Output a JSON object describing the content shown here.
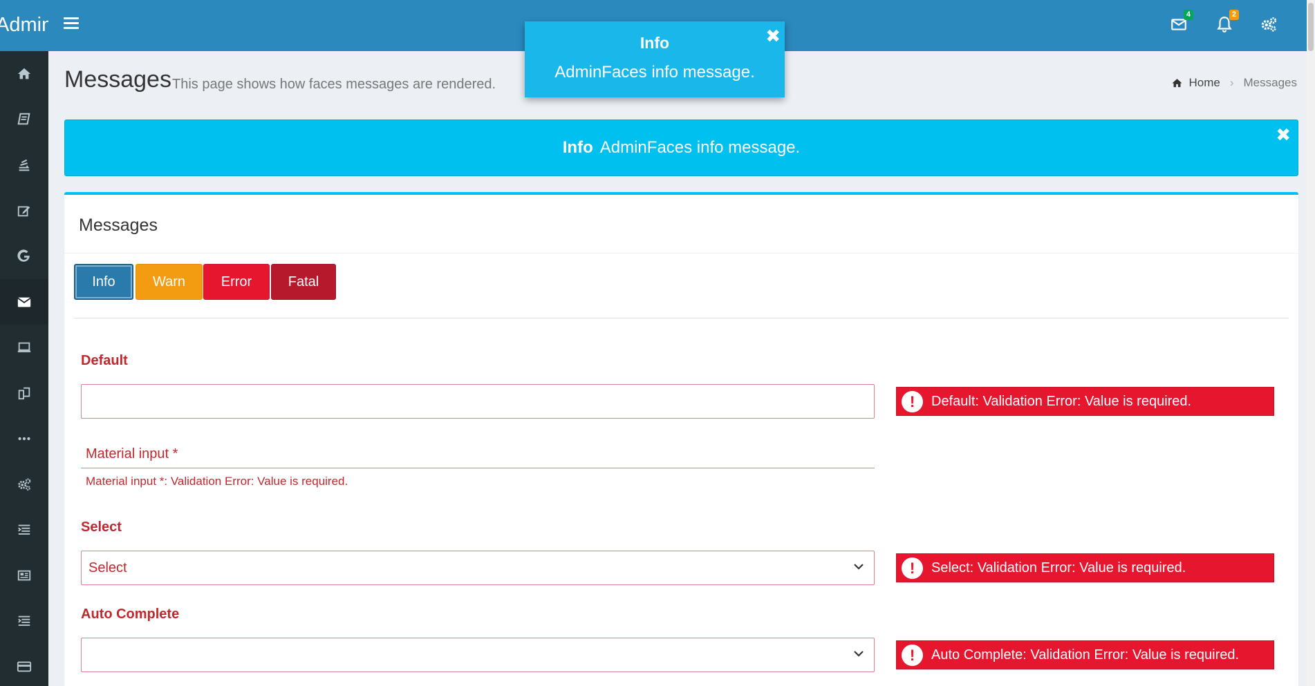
{
  "app": {
    "logo_text": "Admin"
  },
  "topbar": {
    "messages_badge": "4",
    "notifications_badge": "2",
    "badge_colors": {
      "messages": "#00a65a",
      "notifications": "#f39c12"
    }
  },
  "sidebar": {
    "items": [
      {
        "icon": "home-icon"
      },
      {
        "icon": "book-icon"
      },
      {
        "icon": "stack-icon"
      },
      {
        "icon": "edit-icon"
      },
      {
        "icon": "google-icon"
      },
      {
        "icon": "envelope-icon",
        "active": true
      },
      {
        "icon": "laptop-icon"
      },
      {
        "icon": "copy-icon"
      },
      {
        "icon": "ellipsis-icon"
      },
      {
        "icon": "cogs-icon"
      },
      {
        "icon": "list-icon"
      },
      {
        "icon": "newspaper-icon"
      },
      {
        "icon": "list-icon"
      },
      {
        "icon": "credit-card-icon"
      }
    ]
  },
  "header": {
    "title": "Messages",
    "subtitle": "This page shows how faces messages are rendered.",
    "breadcrumb_home": "Home",
    "breadcrumb_current": "Messages"
  },
  "growl": {
    "title": "Info",
    "message": "AdminFaces info message.",
    "close": "✖"
  },
  "alert": {
    "title": "Info",
    "message": "AdminFaces info message.",
    "close": "✖"
  },
  "box": {
    "title": "Messages",
    "buttons": {
      "info": "Info",
      "warn": "Warn",
      "error": "Error",
      "fatal": "Fatal"
    },
    "default": {
      "label": "Default",
      "error": "Default: Validation Error: Value is required."
    },
    "material": {
      "label": "Material input *",
      "error": "Material input *: Validation Error: Value is required."
    },
    "select": {
      "label": "Select",
      "value": "Select",
      "error": "Select: Validation Error: Value is required."
    },
    "autocomplete": {
      "label": "Auto Complete",
      "value": "",
      "error": "Auto Complete: Validation Error: Value is required."
    }
  },
  "colors": {
    "topbar": "#2c89bd",
    "sidebar": "#222d32",
    "info": "#00c0ef",
    "error": "#e7162f",
    "label": "#c1272d"
  }
}
